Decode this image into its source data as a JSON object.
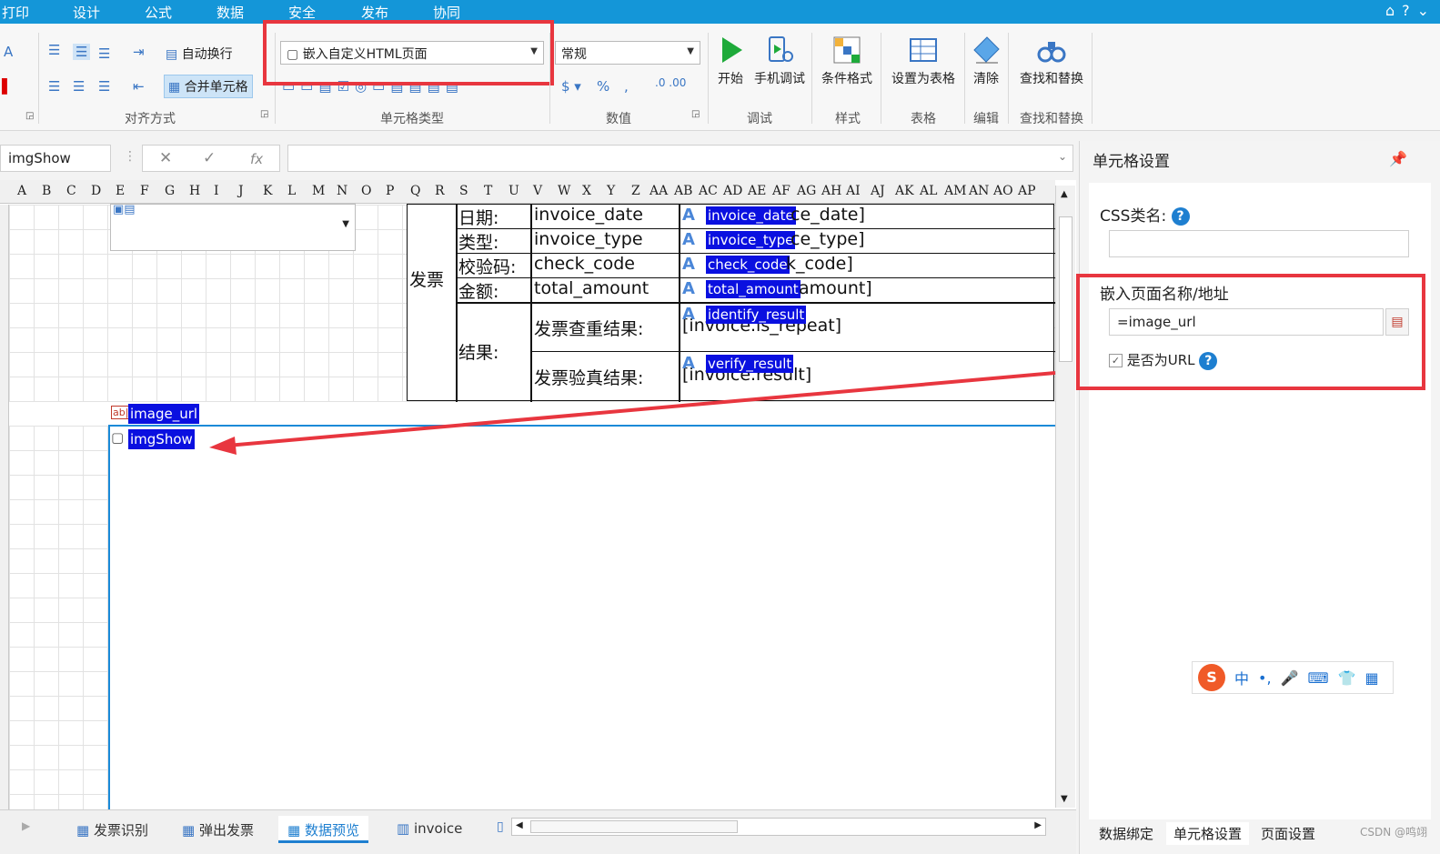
{
  "menu": [
    "打印",
    "设计",
    "公式",
    "数据",
    "安全",
    "发布",
    "协同"
  ],
  "ribbon": {
    "autowrap": "自动换行",
    "merge_cells": "合并单元格",
    "align_group": "对齐方式",
    "cell_type_combo": "嵌入自定义HTML页面",
    "cell_type_group": "单元格类型",
    "number_combo": "常规",
    "number_group": "数值",
    "start": "开始",
    "mobile_debug": "手机调试",
    "debug_group": "调试",
    "cond_format": "条件格式",
    "style_group": "样式",
    "set_table": "设置为表格",
    "table_group": "表格",
    "clear": "清除",
    "edit_group": "编辑",
    "find_replace": "查找和替换",
    "find_group": "查找和替换"
  },
  "formula": {
    "name_box": "imgShow",
    "fx": "fx"
  },
  "columns": [
    "A",
    "B",
    "C",
    "D",
    "E",
    "F",
    "G",
    "H",
    "I",
    "J",
    "K",
    "L",
    "M",
    "N",
    "O",
    "P",
    "Q",
    "R",
    "S",
    "T",
    "U",
    "V",
    "W",
    "X",
    "Y",
    "Z",
    "AA",
    "AB",
    "AC",
    "AD",
    "AE",
    "AF",
    "AG",
    "AH",
    "AI",
    "AJ",
    "AK",
    "AL",
    "AM",
    "AN",
    "AO",
    "AP"
  ],
  "table": {
    "section": "发票",
    "result_label": "结果:",
    "rows": [
      {
        "label": "日期:",
        "field": "invoice_date",
        "tag": "invoice_date",
        "tail": "ce_date]"
      },
      {
        "label": "类型:",
        "field": "invoice_type",
        "tag": "invoice_type",
        "tail": "ce_type]"
      },
      {
        "label": "校验码:",
        "field": "check_code",
        "tag": "check_code",
        "tail": "k_code]"
      },
      {
        "label": "金额:",
        "field": "total_amount",
        "tag": "total_amount",
        "tail": "amount]"
      }
    ],
    "repeat_label": "发票查重结果:",
    "repeat_tag": "identify_result",
    "repeat_value": "[invoice.is_repeat]",
    "verify_label": "发票验真结果:",
    "verify_tag": "verify_result",
    "verify_value": "[invoice.result]"
  },
  "cells": {
    "image_url_tag": "image_url",
    "imgshow_tag": "imgShow"
  },
  "sheet_tabs": [
    "发票识别",
    "弹出发票",
    "数据预览",
    "invoice"
  ],
  "panel": {
    "title": "单元格设置",
    "css_label": "CSS类名:",
    "embed_label": "嵌入页面名称/地址",
    "embed_value": "=image_url",
    "is_url": "是否为URL",
    "tabs": [
      "数据绑定",
      "单元格设置",
      "页面设置"
    ],
    "watermark": "CSDN @鸣翊"
  },
  "ime": {
    "chars": [
      "中",
      "•,",
      "🎤",
      "⌨",
      "👕",
      "▦"
    ]
  }
}
